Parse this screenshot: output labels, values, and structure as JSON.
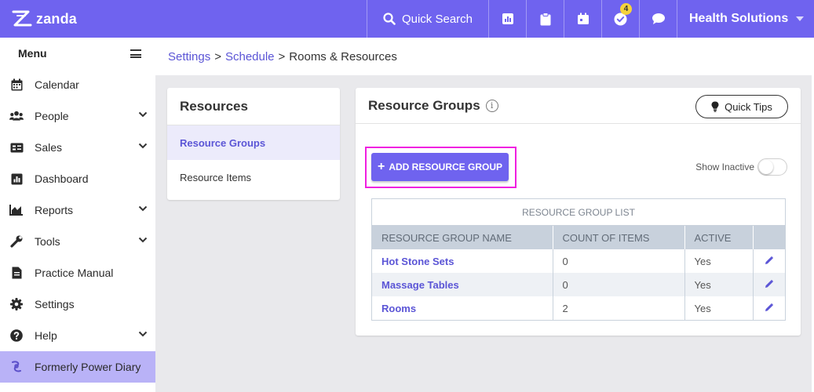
{
  "brand": {
    "name": "zanda",
    "accent": "#6f63ef"
  },
  "topbar": {
    "search_label": "Quick Search",
    "icons": [
      "reports-icon",
      "clipboard-icon",
      "calendar-icon",
      "tasks-icon",
      "chat-icon"
    ],
    "tasks_badge": "4",
    "org_name": "Health Solutions"
  },
  "sidebar": {
    "menu_label": "Menu",
    "items": [
      {
        "label": "Calendar",
        "icon": "calendar-icon",
        "expandable": false
      },
      {
        "label": "People",
        "icon": "people-icon",
        "expandable": true
      },
      {
        "label": "Sales",
        "icon": "sales-icon",
        "expandable": true
      },
      {
        "label": "Dashboard",
        "icon": "dashboard-icon",
        "expandable": false
      },
      {
        "label": "Reports",
        "icon": "reports-icon",
        "expandable": true
      },
      {
        "label": "Tools",
        "icon": "wrench-icon",
        "expandable": true
      },
      {
        "label": "Practice Manual",
        "icon": "document-icon",
        "expandable": false
      },
      {
        "label": "Settings",
        "icon": "gear-icon",
        "expandable": false
      },
      {
        "label": "Help",
        "icon": "help-icon",
        "expandable": true
      },
      {
        "label": "Formerly Power Diary",
        "icon": "power-diary-icon",
        "expandable": false,
        "active": true
      }
    ]
  },
  "breadcrumb": {
    "items": [
      "Settings",
      "Schedule",
      "Rooms & Resources"
    ],
    "separator": ">"
  },
  "resources": {
    "title": "Resources",
    "links": [
      "Resource Groups",
      "Resource Items"
    ],
    "active_index": 0
  },
  "main": {
    "title": "Resource Groups",
    "quick_tips_label": "Quick Tips",
    "add_button_label": "ADD RESOURCE GROUP",
    "add_button_plus": "+",
    "show_inactive_label": "Show Inactive",
    "show_inactive_on": false,
    "table": {
      "caption": "RESOURCE GROUP LIST",
      "columns": [
        "RESOURCE GROUP NAME",
        "COUNT OF ITEMS",
        "ACTIVE",
        ""
      ],
      "rows": [
        {
          "name": "Hot Stone Sets",
          "count": "0",
          "active": "Yes"
        },
        {
          "name": "Massage Tables",
          "count": "0",
          "active": "Yes"
        },
        {
          "name": "Rooms",
          "count": "2",
          "active": "Yes"
        }
      ]
    }
  }
}
